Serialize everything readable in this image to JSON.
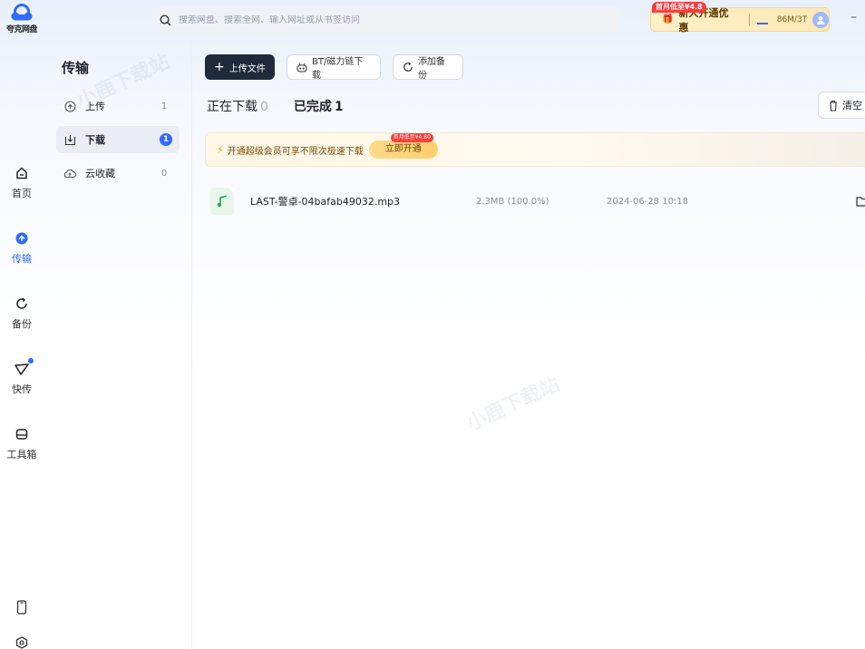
{
  "app": {
    "logo_text": "夸克网盘"
  },
  "rail": {
    "items": [
      {
        "label": "首页",
        "icon": "home-icon"
      },
      {
        "label": "传输",
        "icon": "transfer-icon",
        "active": true
      },
      {
        "label": "备份",
        "icon": "backup-icon"
      },
      {
        "label": "快传",
        "icon": "send-icon",
        "dot": true
      },
      {
        "label": "工具箱",
        "icon": "toolbox-icon"
      }
    ],
    "bottom": [
      "phone-icon",
      "settings-icon"
    ]
  },
  "sidebar": {
    "title": "传输",
    "items": [
      {
        "label": "上传",
        "count": "1",
        "icon": "upload-icon"
      },
      {
        "label": "下载",
        "count": "1",
        "icon": "download-icon",
        "active": true
      },
      {
        "label": "云收藏",
        "count": "0",
        "icon": "cloud-collect-icon"
      }
    ]
  },
  "topbar": {
    "search_placeholder": "搜索网盘、搜索全网、输入网址或从书签访问",
    "promo_tag": "首月低至¥4.8",
    "promo_text": "新人开通优惠",
    "quota": "86M/3T"
  },
  "toolbar": {
    "upload_label": "上传文件",
    "bt_label": "BT/磁力链下载",
    "backup_label": "添加备份"
  },
  "tabs": {
    "downloading_label": "正在下载",
    "downloading_count": "0",
    "done_label": "已完成",
    "done_count": "1",
    "clear_label": "清空"
  },
  "banner": {
    "text": "开通超级会员可享不限次极速下载",
    "button": "立即开通",
    "tag": "首月低至¥4.80"
  },
  "files": [
    {
      "name": "LAST-警卓-04bafab49032.mp3",
      "size": "2.3MB (100.0%)",
      "time": "2024-06-28 10:18",
      "icon": "music-file-icon"
    }
  ],
  "watermark": "小鹿下载站",
  "colors": {
    "accent": "#2f6bff",
    "primary_button": "#1f2a3a",
    "promo": "#ffe8b5",
    "badge_red": "#ff3b3b"
  }
}
